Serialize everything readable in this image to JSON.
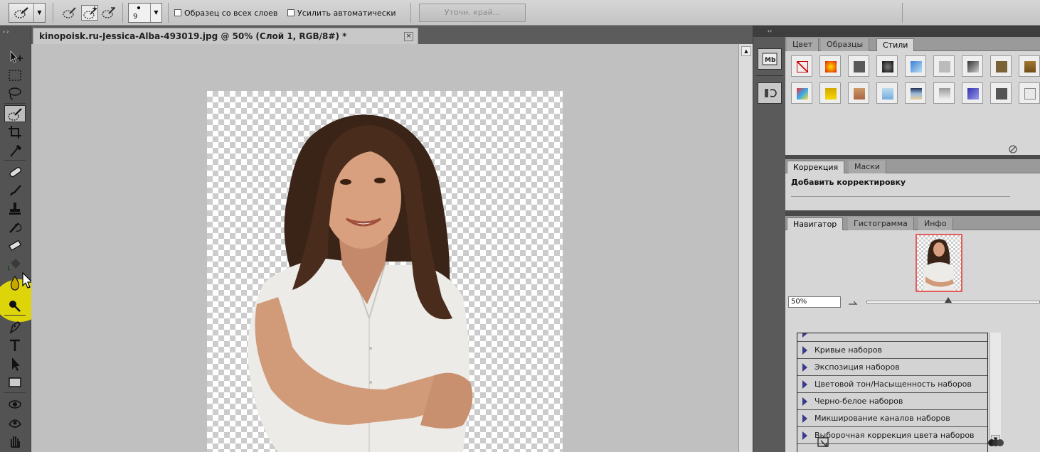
{
  "colors": {
    "workspace_bg": "#c0c0c0",
    "panel_bg": "#d6d6d6",
    "tool_highlight": "#f0e600",
    "nav_frame": "#e35b5b"
  },
  "options_bar": {
    "preset_icon": "quick-selection-brush-icon",
    "brush_size": "9",
    "sample_all_layers_label": "Образец со всех слоев",
    "auto_enhance_label": "Усилить автоматически",
    "refine_edge_label": "Уточн. край..."
  },
  "document": {
    "tab_title": "kinopoisk.ru-Jessica-Alba-493019.jpg @ 50% (Слой 1, RGB/8#) *",
    "close_glyph": "×"
  },
  "toolbar": {
    "grip": "››",
    "tools": [
      "move",
      "marquee",
      "lasso",
      "quick-selection",
      "crop",
      "eyedropper",
      "healing-brush",
      "brush",
      "clone-stamp",
      "history-brush",
      "eraser",
      "paint-bucket",
      "blur",
      "dodge",
      "pen",
      "type",
      "path-selection",
      "rectangle",
      "3d-rotate",
      "3d-orbit",
      "hand"
    ]
  },
  "right_dock": {
    "header_glyph": "‹‹",
    "icons": [
      "mini-bridge-icon",
      "history-icon"
    ]
  },
  "styles_panel": {
    "tabs": [
      "Цвет",
      "Образцы",
      "Стили"
    ],
    "active_tab": "Стили"
  },
  "adjustments_panel": {
    "tabs": [
      "Коррекция",
      "Маски"
    ],
    "title": "Добавить корректировку"
  },
  "navigator_panel": {
    "tabs": [
      "Навигатор",
      "Гистограмма",
      "Инфо"
    ],
    "zoom_value": "50%",
    "zoom_level": 0.47
  },
  "adjustment_presets": {
    "items": [
      "Кривые наборов",
      "Экспозиция наборов",
      "Цветовой тон/Насыщенность наборов",
      "Черно-белое наборов",
      "Микширование каналов наборов",
      "Выборочная коррекция цвета наборов"
    ]
  }
}
